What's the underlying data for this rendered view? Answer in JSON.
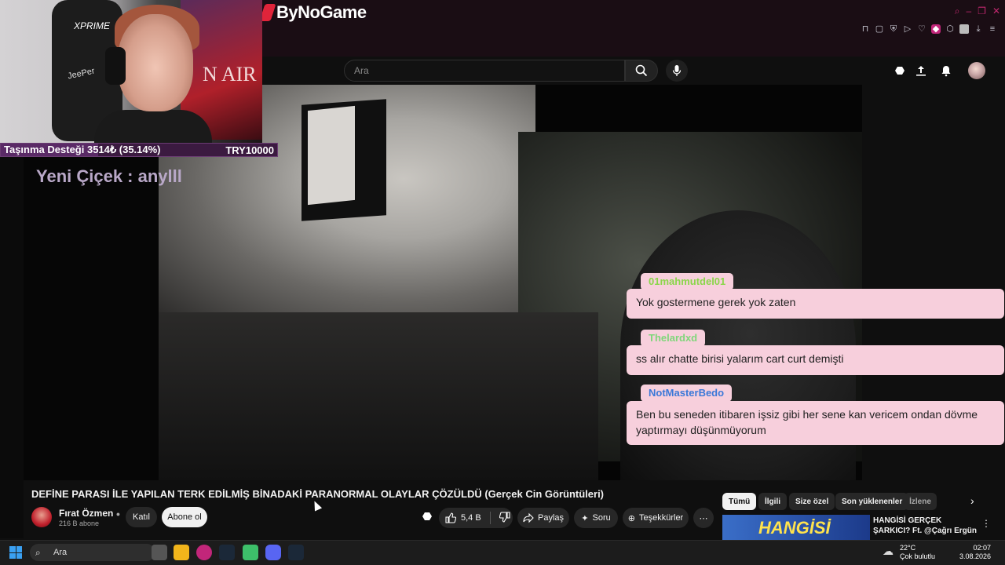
{
  "brand": {
    "name": "ByNoGame"
  },
  "search": {
    "placeholder": "Ara"
  },
  "overlay": {
    "donation_label": "Taşınma Desteği 3514₺ (35.14%)",
    "donation_goal": "TRY10000",
    "donation_progress": 0.3514,
    "new_follower": "Yeni Çiçek : anylll",
    "cam_poster_text": "N AIR",
    "cam_brand": "XPRIME",
    "cam_brand2": "JeePer"
  },
  "chat": [
    {
      "user": "01mahmutdel01",
      "user_color": "#8ad64a",
      "message": "Yok gostermene gerek yok zaten"
    },
    {
      "user": "Thelardxd",
      "user_color": "#7fd67a",
      "message": "ss alır chatte birisi yalarım cart curt demişti"
    },
    {
      "user": "NotMasterBedo",
      "user_color": "#3a78d8",
      "message": "Ben bu seneden itibaren işsiz gibi her sene kan vericem ondan dövme yaptırmayı düşünmüyorum"
    }
  ],
  "video": {
    "title": "DEFİNE PARASI İLE YAPILAN TERK EDİLMİŞ BİNADAKİ PARANORMAL OLAYLAR ÇÖZÜLDÜ (Gerçek Cin Görüntüleri)",
    "channel_name": "Fırat Özmen",
    "subscribers": "216 B abone",
    "join_label": "Katıl",
    "subscribe_label": "Abone ol",
    "likes": "5,4 B",
    "share_label": "Paylaş",
    "ask_label": "Soru",
    "thanks_label": "Teşekkürler"
  },
  "recommend": {
    "chips": [
      "Tümü",
      "İlgili",
      "Size özel",
      "Son yüklenenler",
      "İzlene"
    ],
    "first_title": "HANGİSİ GERÇEK ŞARKICI? Ft. @Çağrı Ergün",
    "first_thumb_text": "HANGİSİ"
  },
  "taskbar": {
    "search_placeholder": "Ara",
    "temperature": "22°C",
    "weather": "Çok bulutlu",
    "time": "02:07",
    "date": "3.08.2026"
  },
  "colors": {
    "chat_bubble": "#f7cfdc",
    "donation_bar": "#3b1a40",
    "youtube_bg": "#0f0f0f"
  }
}
